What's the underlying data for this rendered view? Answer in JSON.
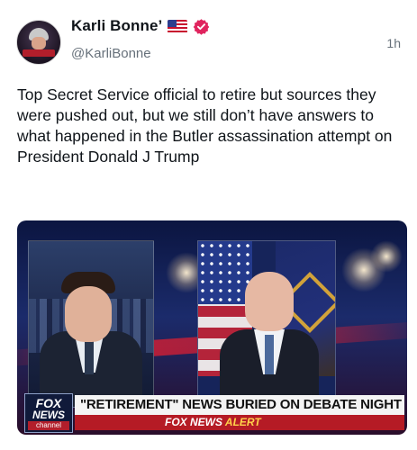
{
  "post": {
    "author": {
      "display_name": "Karli Bonne’",
      "handle": "@KarliBonne",
      "flag_icon": "us-flag-icon",
      "verified_icon": "verified-badge-icon"
    },
    "timestamp": "1h",
    "text": "Top Secret Service official to retire but sources they were pushed out, but we still don’t have answers to what happened in the Butler assassination attempt on President Donald J Trump",
    "media": {
      "chyron_headline": "\"RETIREMENT\" NEWS BURIED ON DEBATE NIGHT",
      "alert_brand": "FOX NEWS",
      "alert_word": "ALERT",
      "logo_line1": "FOX",
      "logo_line2": "NEWS",
      "logo_line3": "channel"
    }
  },
  "colors": {
    "verified": "#e0245e",
    "handle_gray": "#66707a",
    "chyron_red": "#b51b25"
  }
}
